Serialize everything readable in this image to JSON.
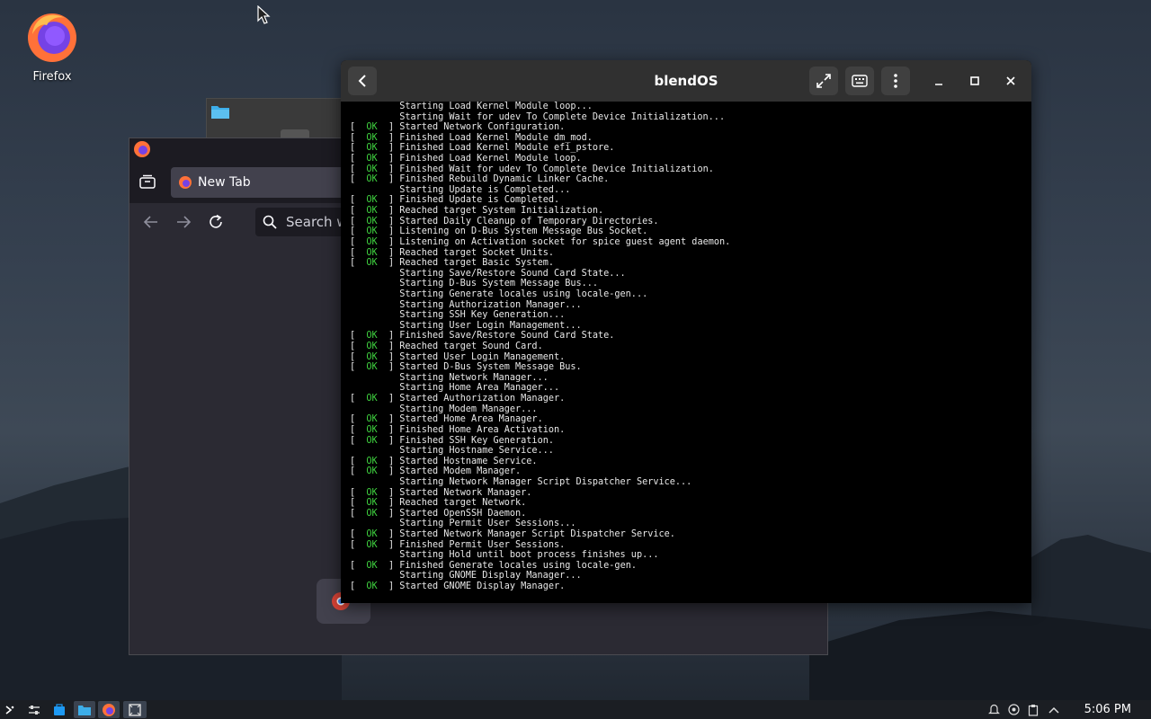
{
  "desktop": {
    "icon_label": "Firefox"
  },
  "firefox": {
    "tab_title": "New Tab",
    "search_placeholder": "Search w"
  },
  "terminal": {
    "title": "blendOS",
    "ok_text": "OK",
    "lines": [
      {
        "ok": false,
        "text": "Starting Load Kernel Module loop..."
      },
      {
        "ok": false,
        "text": "Starting Wait for udev To Complete Device Initialization..."
      },
      {
        "ok": true,
        "text": "Started Network Configuration."
      },
      {
        "ok": true,
        "text": "Finished Load Kernel Module dm_mod."
      },
      {
        "ok": true,
        "text": "Finished Load Kernel Module efi_pstore."
      },
      {
        "ok": true,
        "text": "Finished Load Kernel Module loop."
      },
      {
        "ok": true,
        "text": "Finished Wait for udev To Complete Device Initialization."
      },
      {
        "ok": true,
        "text": "Finished Rebuild Dynamic Linker Cache."
      },
      {
        "ok": false,
        "text": "Starting Update is Completed..."
      },
      {
        "ok": true,
        "text": "Finished Update is Completed."
      },
      {
        "ok": true,
        "text": "Reached target System Initialization."
      },
      {
        "ok": true,
        "text": "Started Daily Cleanup of Temporary Directories."
      },
      {
        "ok": true,
        "text": "Listening on D-Bus System Message Bus Socket."
      },
      {
        "ok": true,
        "text": "Listening on Activation socket for spice guest agent daemon."
      },
      {
        "ok": true,
        "text": "Reached target Socket Units."
      },
      {
        "ok": true,
        "text": "Reached target Basic System."
      },
      {
        "ok": false,
        "text": "Starting Save/Restore Sound Card State..."
      },
      {
        "ok": false,
        "text": "Starting D-Bus System Message Bus..."
      },
      {
        "ok": false,
        "text": "Starting Generate locales using locale-gen..."
      },
      {
        "ok": false,
        "text": "Starting Authorization Manager..."
      },
      {
        "ok": false,
        "text": "Starting SSH Key Generation..."
      },
      {
        "ok": false,
        "text": "Starting User Login Management..."
      },
      {
        "ok": true,
        "text": "Finished Save/Restore Sound Card State."
      },
      {
        "ok": true,
        "text": "Reached target Sound Card."
      },
      {
        "ok": true,
        "text": "Started User Login Management."
      },
      {
        "ok": true,
        "text": "Started D-Bus System Message Bus."
      },
      {
        "ok": false,
        "text": "Starting Network Manager..."
      },
      {
        "ok": false,
        "text": "Starting Home Area Manager..."
      },
      {
        "ok": true,
        "text": "Started Authorization Manager."
      },
      {
        "ok": false,
        "text": "Starting Modem Manager..."
      },
      {
        "ok": true,
        "text": "Started Home Area Manager."
      },
      {
        "ok": true,
        "text": "Finished Home Area Activation."
      },
      {
        "ok": true,
        "text": "Finished SSH Key Generation."
      },
      {
        "ok": false,
        "text": "Starting Hostname Service..."
      },
      {
        "ok": true,
        "text": "Started Hostname Service."
      },
      {
        "ok": true,
        "text": "Started Modem Manager."
      },
      {
        "ok": false,
        "text": "Starting Network Manager Script Dispatcher Service..."
      },
      {
        "ok": true,
        "text": "Started Network Manager."
      },
      {
        "ok": true,
        "text": "Reached target Network."
      },
      {
        "ok": true,
        "text": "Started OpenSSH Daemon."
      },
      {
        "ok": false,
        "text": "Starting Permit User Sessions..."
      },
      {
        "ok": true,
        "text": "Started Network Manager Script Dispatcher Service."
      },
      {
        "ok": true,
        "text": "Finished Permit User Sessions."
      },
      {
        "ok": false,
        "text": "Starting Hold until boot process finishes up..."
      },
      {
        "ok": true,
        "text": "Finished Generate locales using locale-gen."
      },
      {
        "ok": false,
        "text": "Starting GNOME Display Manager..."
      },
      {
        "ok": true,
        "text": "Started GNOME Display Manager."
      }
    ]
  },
  "taskbar": {
    "clock": "5:06 PM"
  },
  "colors": {
    "ok_green": "#3fd13f",
    "terminal_header": "#303030",
    "firefox_orange": "#ff7139"
  }
}
